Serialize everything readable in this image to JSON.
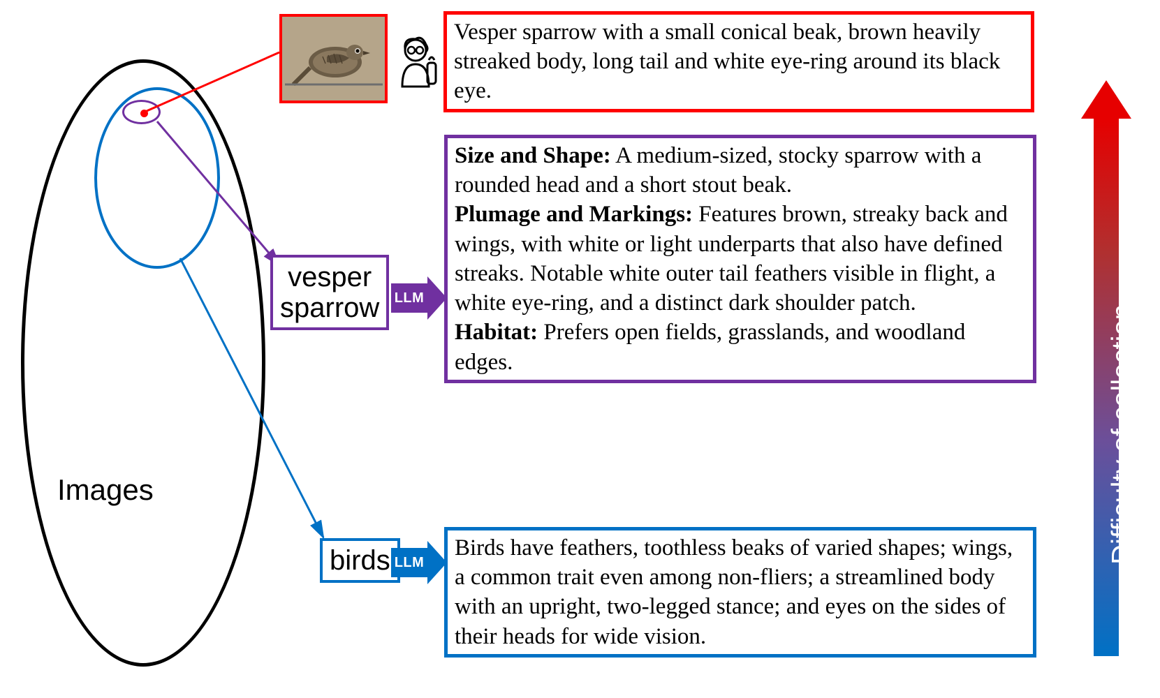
{
  "ellipse_label": "Images",
  "llm_label": "LLM",
  "difficulty_label": "Difficulty of collection",
  "tags": {
    "species": "vesper\nsparrow",
    "category": "birds"
  },
  "descriptions": {
    "instance": "Vesper sparrow with a small conical beak, brown heavily streaked body, long tail and white eye-ring around its black eye.",
    "species": {
      "size_label": "Size and Shape:",
      "size_text": " A medium-sized, stocky sparrow with a rounded head and a short stout beak.",
      "plumage_label": "Plumage and Markings:",
      "plumage_text": " Features brown, streaky back and wings, with white or light underparts that also have defined streaks. Notable white outer tail feathers visible in flight, a white eye-ring, and a distinct dark shoulder patch.",
      "habitat_label": "Habitat:",
      "habitat_text": " Prefers open fields, grasslands, and woodland edges."
    },
    "category": "Birds have feathers, toothless beaks of varied shapes; wings, a common trait even among non-fliers; a streamlined body with an upright, two-legged stance; and eyes on the sides of their heads for wide vision."
  },
  "colors": {
    "red": "#ff0000",
    "purple": "#7030a0",
    "blue": "#0071c5",
    "black": "#000000"
  },
  "chart_data": null
}
